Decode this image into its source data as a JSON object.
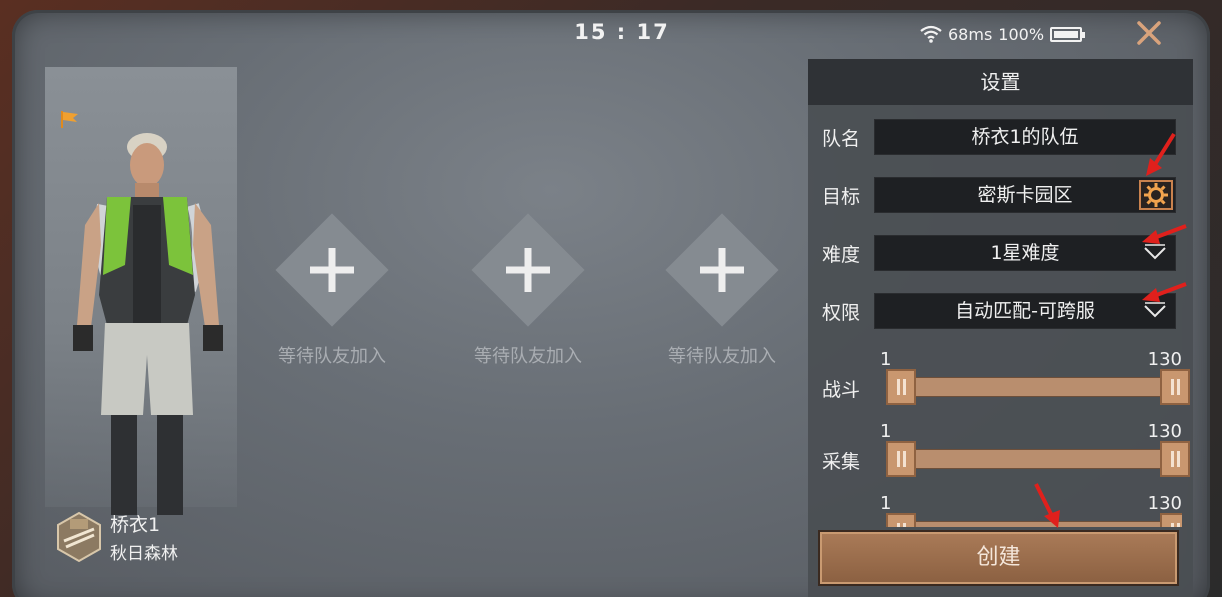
{
  "status_bar": {
    "time": "15 : 17",
    "ping": "68ms",
    "battery": "100%",
    "battery_level": 1.0
  },
  "player": {
    "name": "桥衣1",
    "map": "秋日森林"
  },
  "slots": [
    {
      "label": "等待队友加入"
    },
    {
      "label": "等待队友加入"
    },
    {
      "label": "等待队友加入"
    }
  ],
  "settings": {
    "title": "设置",
    "team_name": {
      "label": "队名",
      "value": "桥衣1的队伍"
    },
    "target": {
      "label": "目标",
      "value": "密斯卡园区"
    },
    "difficulty": {
      "label": "难度",
      "value": "1星难度"
    },
    "permission": {
      "label": "权限",
      "value": "自动匹配-可跨服"
    },
    "combat": {
      "label": "战斗",
      "min": "1",
      "max": "130"
    },
    "gather": {
      "label": "采集",
      "min": "1",
      "max": "130"
    },
    "third": {
      "min": "1",
      "max": "130"
    }
  },
  "create_button": "创建",
  "colors": {
    "accent": "#c9824e",
    "slider": "#b98e6e",
    "annotation_arrow": "#e0201c"
  },
  "icons": [
    "close-icon",
    "wifi-icon",
    "battery-icon",
    "flag-icon",
    "rank-icon",
    "plus-icon",
    "gear-icon",
    "chevron-down-icon"
  ]
}
